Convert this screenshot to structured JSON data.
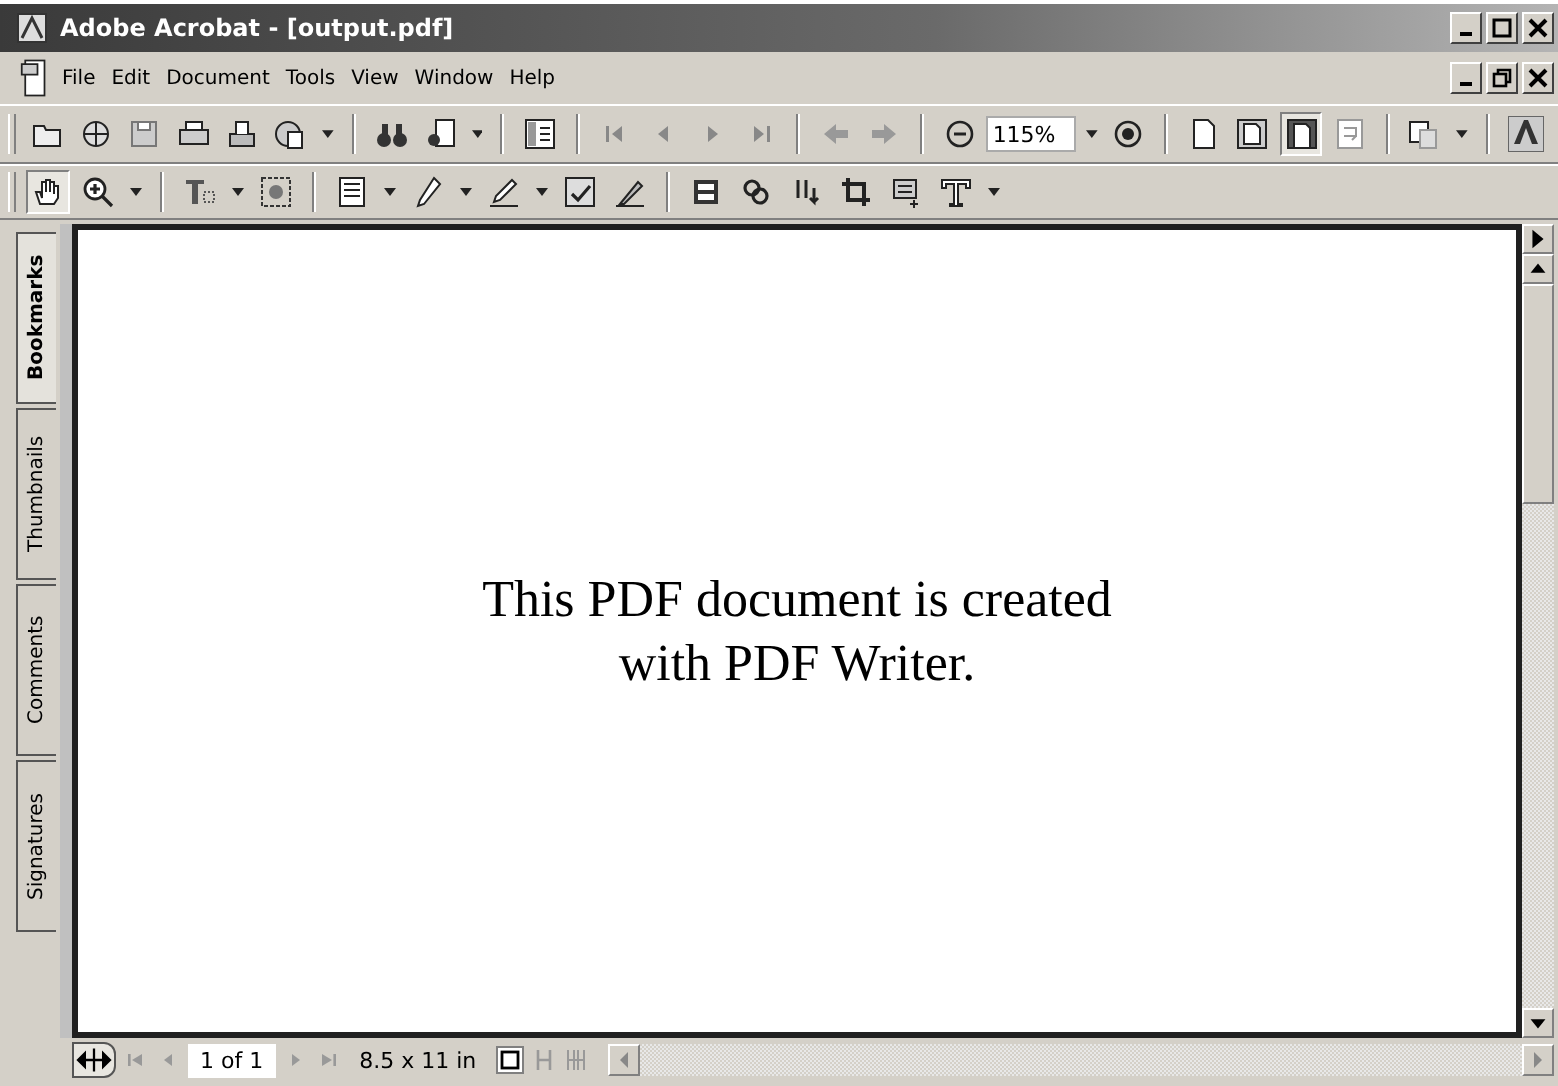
{
  "window": {
    "title": "Adobe Acrobat - [output.pdf]"
  },
  "menu": [
    "File",
    "Edit",
    "Document",
    "Tools",
    "View",
    "Window",
    "Help"
  ],
  "toolbar": {
    "zoom": "115%"
  },
  "side_tabs": [
    {
      "label": "Bookmarks",
      "selected": true
    },
    {
      "label": "Thumbnails",
      "selected": false
    },
    {
      "label": "Comments",
      "selected": false
    },
    {
      "label": "Signatures",
      "selected": false
    }
  ],
  "document": {
    "lines": [
      "This PDF document is created",
      "with PDF Writer."
    ]
  },
  "status_bar": {
    "page": "1 of 1",
    "page_size": "8.5 x 11 in"
  }
}
